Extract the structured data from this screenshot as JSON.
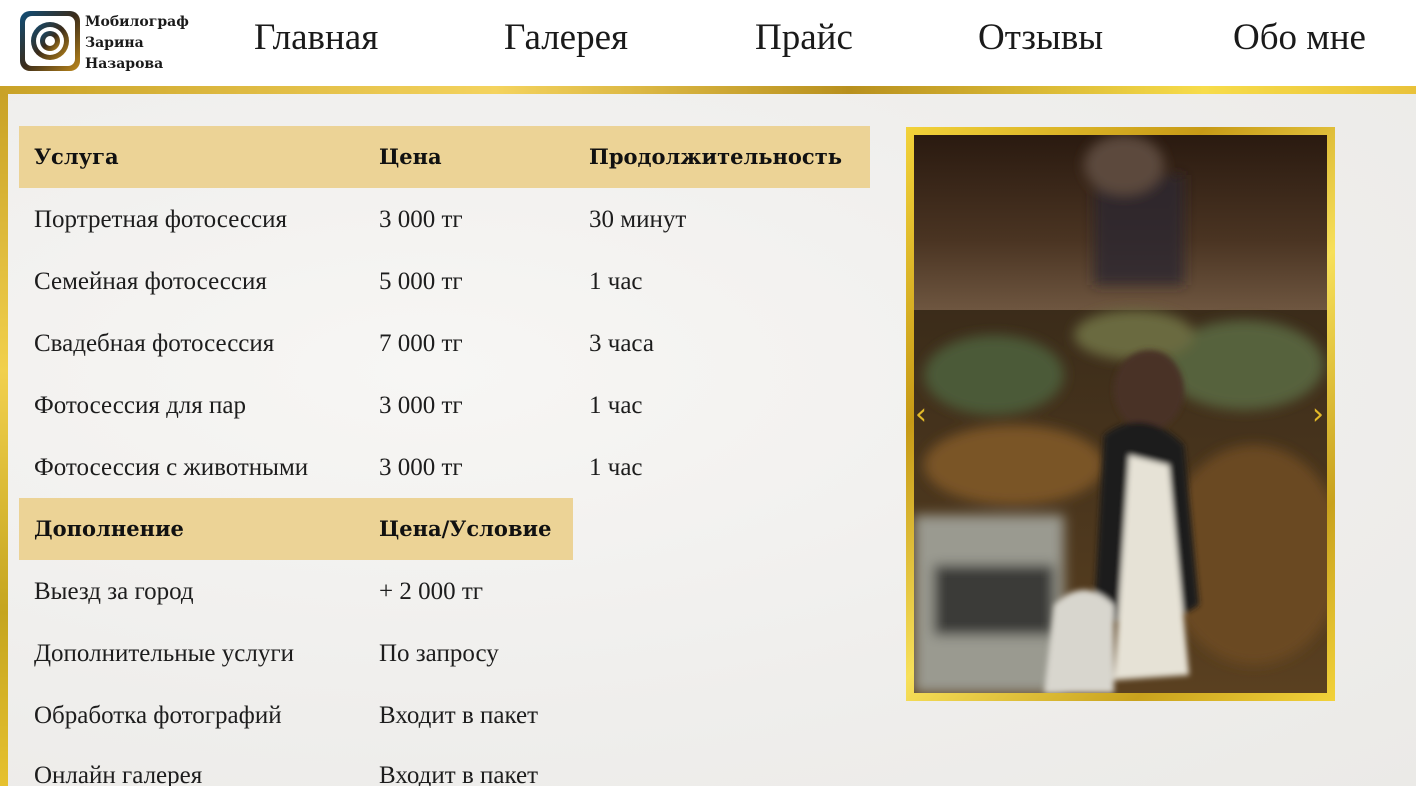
{
  "brand": {
    "line1": "Мобилограф",
    "line2": "Зарина",
    "line3": "Назарова",
    "logo_icon": "camera-lens-logo"
  },
  "nav": [
    "Главная",
    "Галерея",
    "Прайс",
    "Отзывы",
    "Обо мне"
  ],
  "services_table": {
    "headers": [
      "Услуга",
      "Цена",
      "Продолжительность"
    ],
    "rows": [
      [
        "Портретная фотосессия",
        "3 000 тг",
        "30 минут"
      ],
      [
        "Семейная фотосессия",
        "5 000 тг",
        "1 час"
      ],
      [
        "Свадебная фотосессия",
        "7 000 тг",
        "3 часа"
      ],
      [
        "Фотосессия для пар",
        "3 000 тг",
        "1 час"
      ],
      [
        "Фотосессия с животными",
        "3 000 тг",
        "1 час"
      ]
    ]
  },
  "extras_table": {
    "headers": [
      "Дополнение",
      "Цена/Условие"
    ],
    "rows": [
      [
        "Выезд за город",
        "+ 2 000 тг"
      ],
      [
        "Дополнительные услуги",
        "По запросу"
      ],
      [
        "Обработка фотографий",
        "Входит в пакет"
      ],
      [
        "Онлайн галерея",
        "Входит в пакет"
      ]
    ]
  },
  "slider": {
    "prev_icon": "chevron-left-icon",
    "next_icon": "chevron-right-icon",
    "prev_glyph": "‹",
    "next_glyph": "›"
  },
  "colors": {
    "accent_gold": "#f4d35e",
    "table_header": "#ecd396",
    "background": "#f3f2f0"
  }
}
